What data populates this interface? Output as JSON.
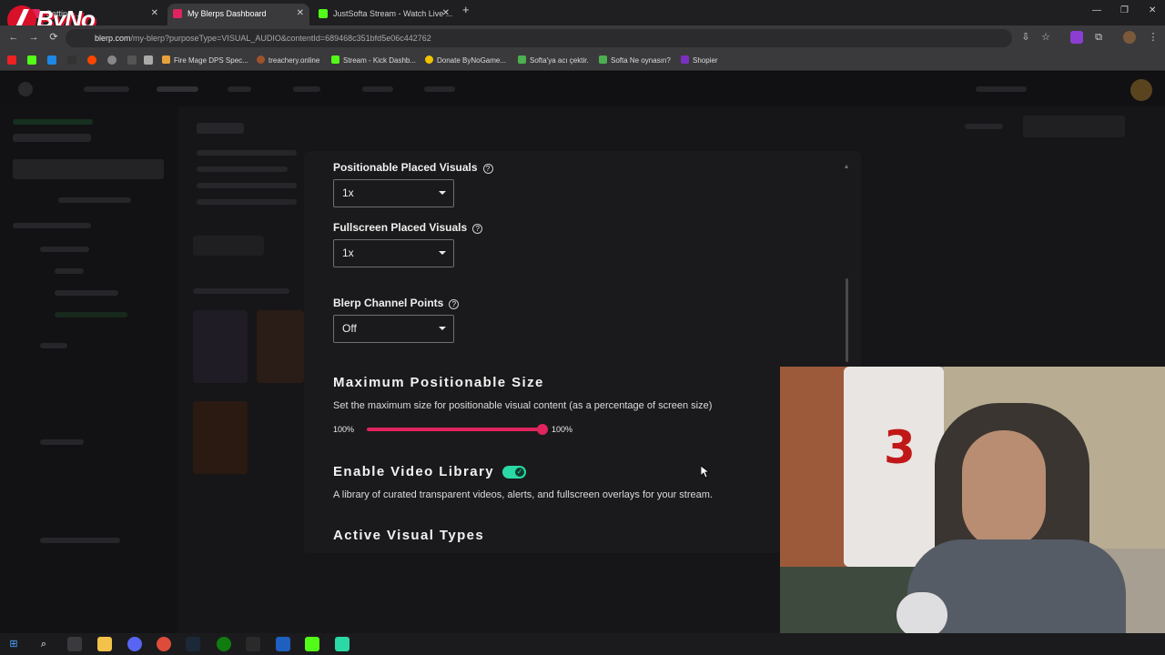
{
  "browser": {
    "tabs": [
      {
        "title": "Getting ...",
        "active": false
      },
      {
        "title": "My Blerps Dashboard",
        "active": true
      },
      {
        "title": "JustSofta Stream - Watch Live ...",
        "active": false
      }
    ],
    "new_tab": "+",
    "url_host": "blerp.com",
    "url_path": "/my-blerp?purposeType=VISUAL_AUDIO&contentId=689468c351bfd5e06c442762",
    "bookmarks": [
      "Fire Mage DPS Spec...",
      "treachery.online",
      "Stream - Kick Dashb...",
      "Donate ByNoGame...",
      "Softa'ya acı çektir.",
      "Softa Ne oynasın?",
      "Shopier"
    ]
  },
  "overlay_logo": "ByNo",
  "modal": {
    "positionable_label": "Positionable Placed Visuals",
    "positionable_value": "1x",
    "fullscreen_label": "Fullscreen Placed Visuals",
    "fullscreen_value": "1x",
    "channel_points_label": "Blerp Channel Points",
    "channel_points_value": "Off",
    "max_size_heading": "Maximum Positionable Size",
    "max_size_desc": "Set the maximum size for positionable visual content (as a percentage of screen size)",
    "slider_min_label": "100%",
    "slider_max_label": "100%",
    "slider_level": 1.0,
    "video_library_heading": "Enable Video Library",
    "video_library_enabled": true,
    "video_library_desc": "A library of curated transparent videos, alerts, and fullscreen overlays for your stream.",
    "active_types_heading": "Active Visual Types"
  },
  "colors": {
    "accent_pink": "#e0245e",
    "toggle_green": "#2bd9a6"
  }
}
